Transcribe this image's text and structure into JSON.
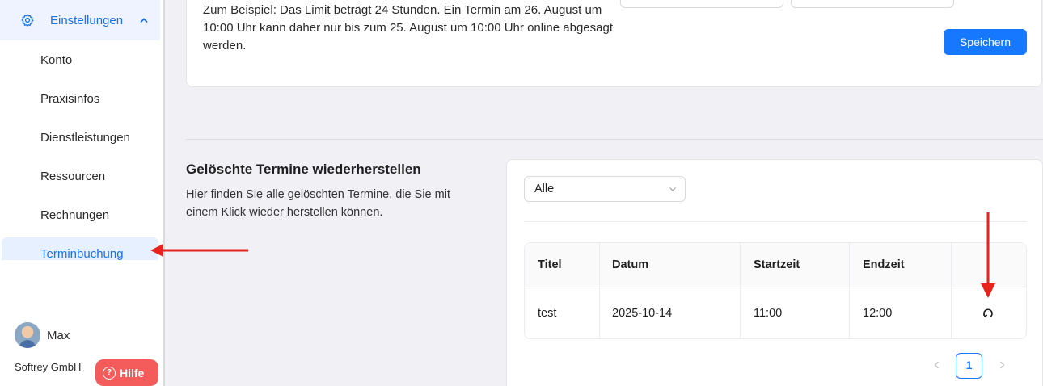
{
  "sidebar": {
    "settings_label": "Einstellungen",
    "items": [
      {
        "label": "Konto"
      },
      {
        "label": "Praxisinfos"
      },
      {
        "label": "Dienstleistungen"
      },
      {
        "label": "Ressourcen"
      },
      {
        "label": "Rechnungen"
      },
      {
        "label": "Terminbuchung",
        "active": true
      }
    ],
    "user_name": "Max",
    "company": "Softrey GmbH",
    "help_label": "Hilfe"
  },
  "top_card": {
    "example_text": "Zum Beispiel: Das Limit beträgt 24 Stunden. Ein Termin am 26. August um 10:00 Uhr kann daher nur bis zum 25. August um 10:00 Uhr online abgesagt werden.",
    "save_label": "Speichern"
  },
  "deleted": {
    "title": "Gelöschte Termine wiederherstellen",
    "description": "Hier finden Sie alle gelöschten Termine, die Sie mit einem Klick wieder herstellen können.",
    "filter_value": "Alle",
    "columns": [
      "Titel",
      "Datum",
      "Startzeit",
      "Endzeit"
    ],
    "rows": [
      {
        "title": "test",
        "date": "2025-10-14",
        "start": "11:00",
        "end": "12:00"
      }
    ],
    "current_page": "1"
  },
  "colors": {
    "accent": "#1677ff",
    "help": "#f45b5b",
    "annotation": "#e8231d"
  }
}
